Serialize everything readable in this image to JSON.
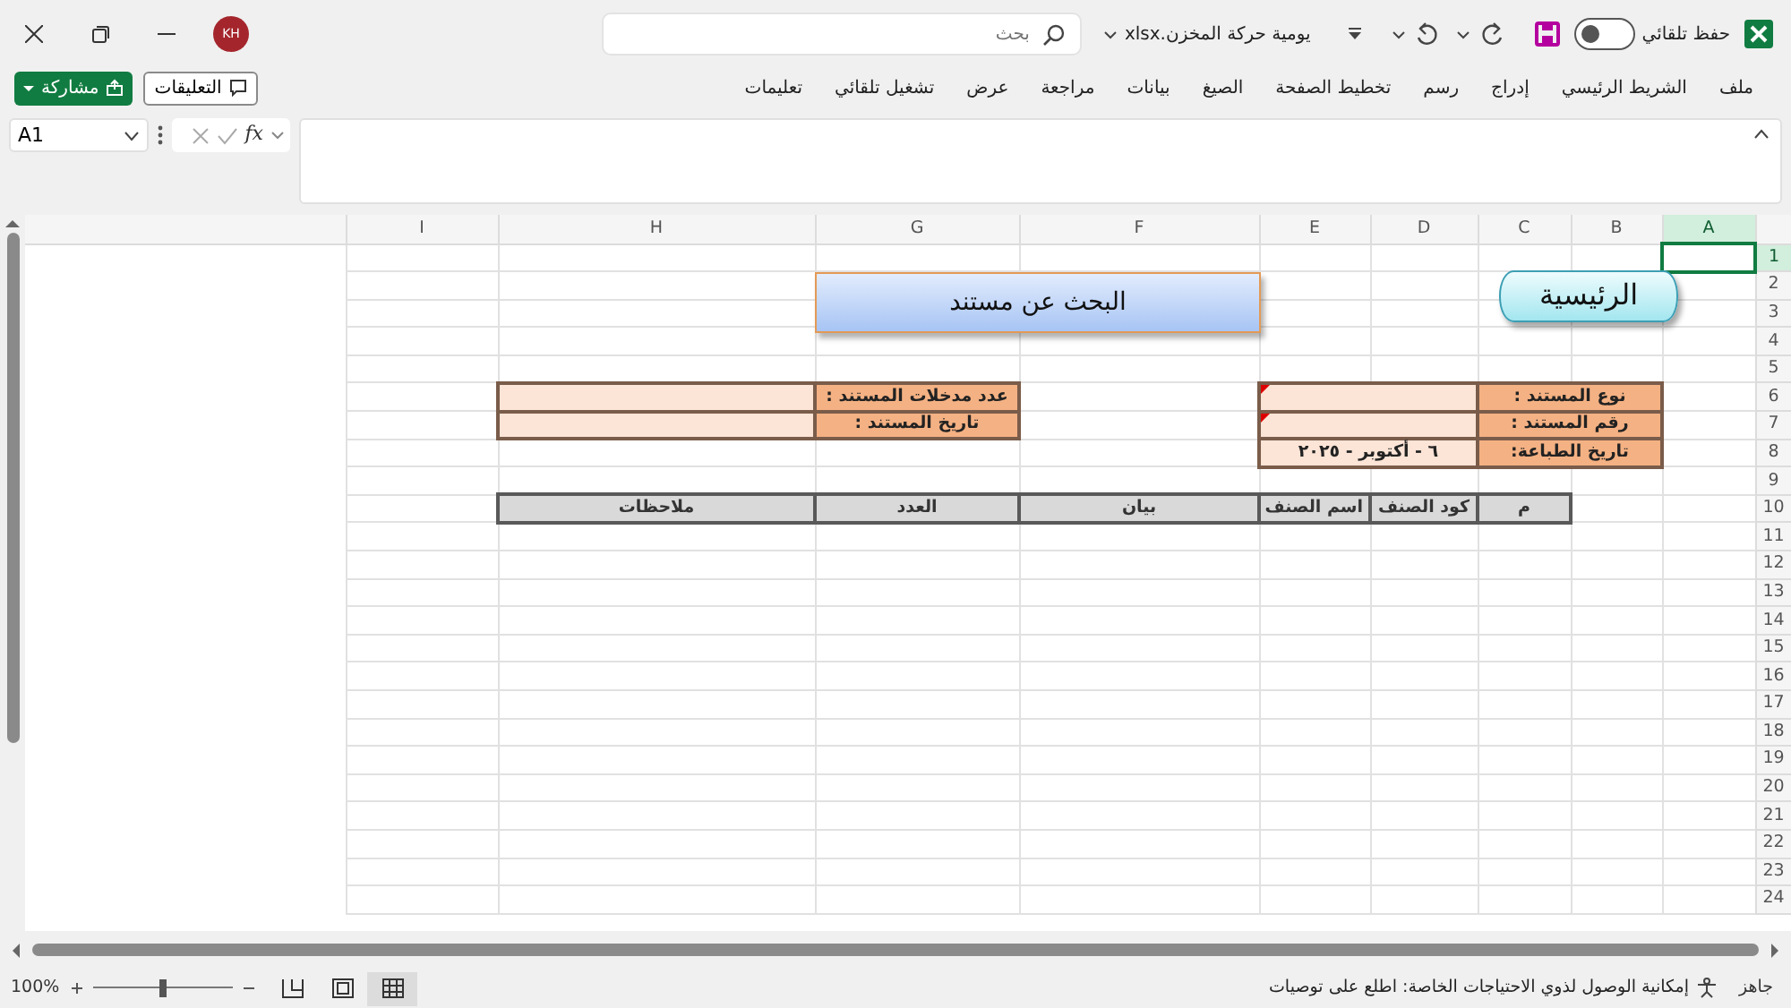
{
  "title_bar": {
    "autosave": {
      "label": "حفظ تلقائي",
      "on": false
    },
    "file_name": "يومية حركة المخزن.xlsx",
    "search": {
      "placeholder": "بحث"
    },
    "avatar": "KH"
  },
  "ribbon_tabs": [
    {
      "label": "ملف",
      "selected": false
    },
    {
      "label": "الشريط الرئيسي",
      "selected": false
    },
    {
      "label": "إدراج",
      "selected": false
    },
    {
      "label": "رسم",
      "selected": false
    },
    {
      "label": "تخطيط الصفحة",
      "selected": false
    },
    {
      "label": "الصيغ",
      "selected": false
    },
    {
      "label": "بيانات",
      "selected": false
    },
    {
      "label": "مراجعة",
      "selected": false
    },
    {
      "label": "عرض",
      "selected": false
    },
    {
      "label": "تشغيل تلقائي",
      "selected": false
    },
    {
      "label": "تعليمات",
      "selected": false
    }
  ],
  "ribbon_buttons": [
    {
      "kind": "comments",
      "label": "التعليقات"
    },
    {
      "kind": "share",
      "label": "مشاركة"
    }
  ],
  "formula_bar": {
    "name_box": "A1",
    "function_label": "fx"
  },
  "sheet": {
    "columns": [
      {
        "label": "A",
        "selected": true
      },
      {
        "label": "B",
        "selected": false
      },
      {
        "label": "C",
        "selected": false
      },
      {
        "label": "D",
        "selected": false
      },
      {
        "label": "E",
        "selected": false
      },
      {
        "label": "F",
        "selected": false
      },
      {
        "label": "G",
        "selected": false
      },
      {
        "label": "H",
        "selected": false
      },
      {
        "label": "I",
        "selected": false
      }
    ],
    "rows": [
      {
        "label": "1",
        "selected": true
      },
      {
        "label": "2",
        "selected": false
      },
      {
        "label": "3",
        "selected": false
      },
      {
        "label": "4",
        "selected": false
      },
      {
        "label": "5",
        "selected": false
      },
      {
        "label": "6",
        "selected": false
      },
      {
        "label": "7",
        "selected": false
      },
      {
        "label": "8",
        "selected": false
      },
      {
        "label": "9",
        "selected": false
      },
      {
        "label": "10",
        "selected": false
      },
      {
        "label": "11",
        "selected": false
      },
      {
        "label": "12",
        "selected": false
      },
      {
        "label": "13",
        "selected": false
      },
      {
        "label": "14",
        "selected": false
      },
      {
        "label": "15",
        "selected": false
      },
      {
        "label": "16",
        "selected": false
      },
      {
        "label": "17",
        "selected": false
      },
      {
        "label": "18",
        "selected": false
      },
      {
        "label": "19",
        "selected": false
      },
      {
        "label": "20",
        "selected": false
      },
      {
        "label": "21",
        "selected": false
      },
      {
        "label": "22",
        "selected": false
      },
      {
        "label": "23",
        "selected": false
      },
      {
        "label": "24",
        "selected": false
      }
    ],
    "home_shape": "الرئيسية",
    "search_shape": "البحث عن مستند",
    "document_fields": [
      {
        "label": "نوع المستند :",
        "has_comment": true
      },
      {
        "label": "رقم المستند :",
        "has_comment": true
      },
      {
        "label": "تاريخ الطباعة:",
        "value": "٦ - أكتوبر - ٢٠٢٥",
        "has_comment": false
      }
    ],
    "entry_fields": [
      {
        "label": "عدد مدخلات المستند :"
      },
      {
        "label": "تاريخ المستند :"
      }
    ],
    "table_headers": [
      "م",
      "كود الصنف",
      "اسم الصنف",
      "بيان",
      "العدد",
      "ملاحظات"
    ]
  },
  "status_bar": {
    "status": "جاهز",
    "accessibility": "إمكانية الوصول لذوي الاحتياجات الخاصة: اطلع على توصيات",
    "views": [
      {
        "kind": "normal",
        "selected": true
      },
      {
        "kind": "page_layout",
        "selected": false
      },
      {
        "kind": "page_break",
        "selected": false
      }
    ],
    "zoom": {
      "level": 0.5,
      "label": "100%"
    }
  }
}
